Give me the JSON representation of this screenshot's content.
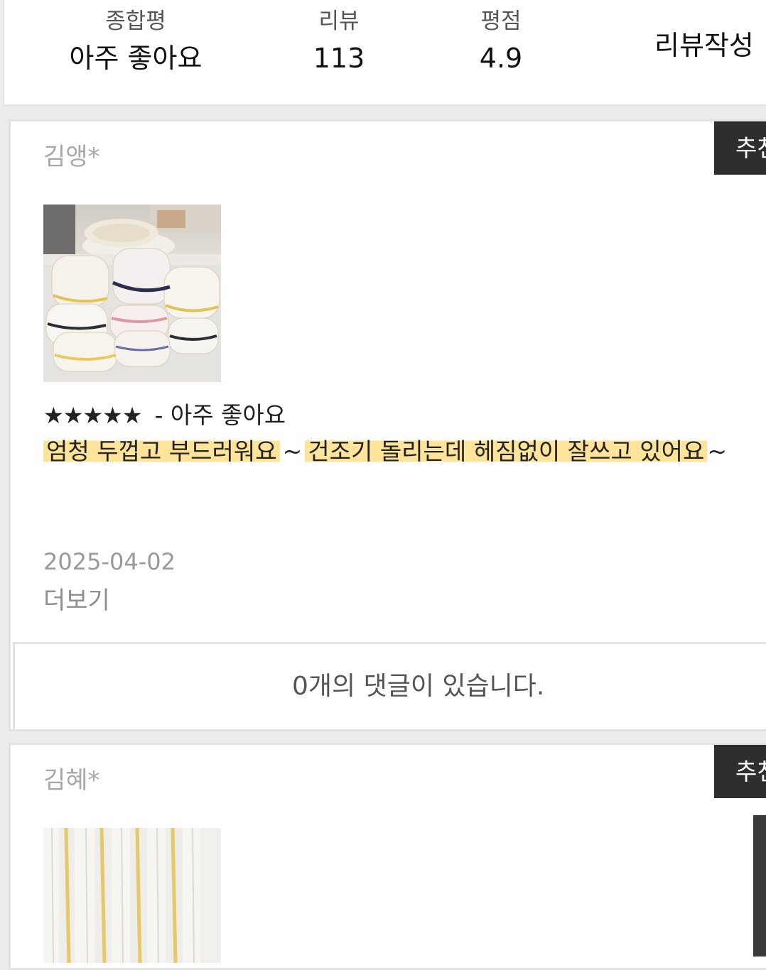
{
  "summary": {
    "overall_label": "종합평",
    "overall_value": "아주 좋아요",
    "reviews_label": "리뷰",
    "reviews_value": "113",
    "rating_label": "평점",
    "rating_value": "4.9",
    "write_review_label": "리뷰작성"
  },
  "reviews": [
    {
      "author": "김앵*",
      "recommend_label": "추천",
      "photo_icon": "folded-towels-photo",
      "stars": "★★★★★",
      "star_count": 5,
      "rating_text": "- 아주 좋아요",
      "body_part1": "엄청 두껍고 부드러워요",
      "body_tilde1": "~",
      "body_part2": "건조기 돌리는데 헤짐없이 잘쓰고 있어요",
      "body_tilde2": "~",
      "highlight_color": "#fde49a",
      "date": "2025-04-02",
      "more_label": "더보기",
      "comments_text": "0개의 댓글이 있습니다."
    },
    {
      "author": "김혜*",
      "recommend_label": "추천",
      "photo_icon": "striped-towel-photo"
    }
  ],
  "colors": {
    "recommend_bg": "#2e2e2e",
    "page_bg": "#ececec",
    "muted_text": "#a8a8a8"
  }
}
